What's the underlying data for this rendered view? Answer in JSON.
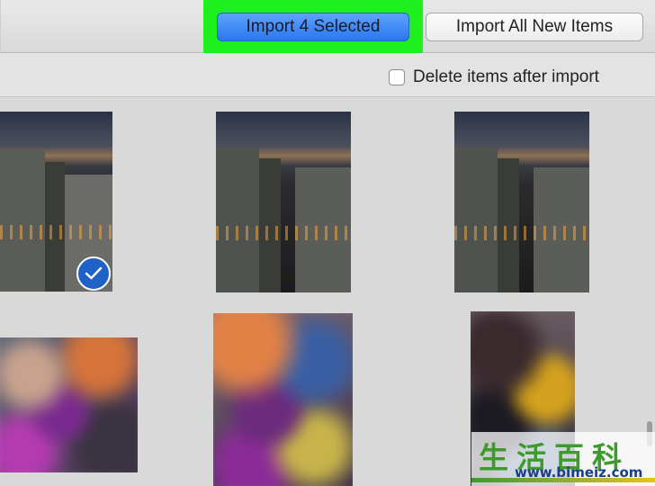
{
  "toolbar": {
    "import_selected_label": "Import 4 Selected",
    "import_all_label": "Import All New Items"
  },
  "options": {
    "delete_after_import_label": "Delete items after import",
    "delete_after_import_checked": false
  },
  "photos": [
    {
      "kind": "night-city",
      "selected": true
    },
    {
      "kind": "night-city",
      "selected": false
    },
    {
      "kind": "night-city",
      "selected": false
    },
    {
      "kind": "blurred",
      "selected": false
    },
    {
      "kind": "blurred",
      "selected": false
    },
    {
      "kind": "blurred",
      "selected": false
    }
  ],
  "icons": {
    "selected_badge": "checkmark-icon"
  },
  "watermark": {
    "chars": [
      "生",
      "活",
      "百",
      "科"
    ],
    "url": "www.bimeiz.com"
  },
  "colors": {
    "highlight": "#1ef01e",
    "primary_button": "#2a77f0",
    "selected_badge": "#1e62c7"
  }
}
